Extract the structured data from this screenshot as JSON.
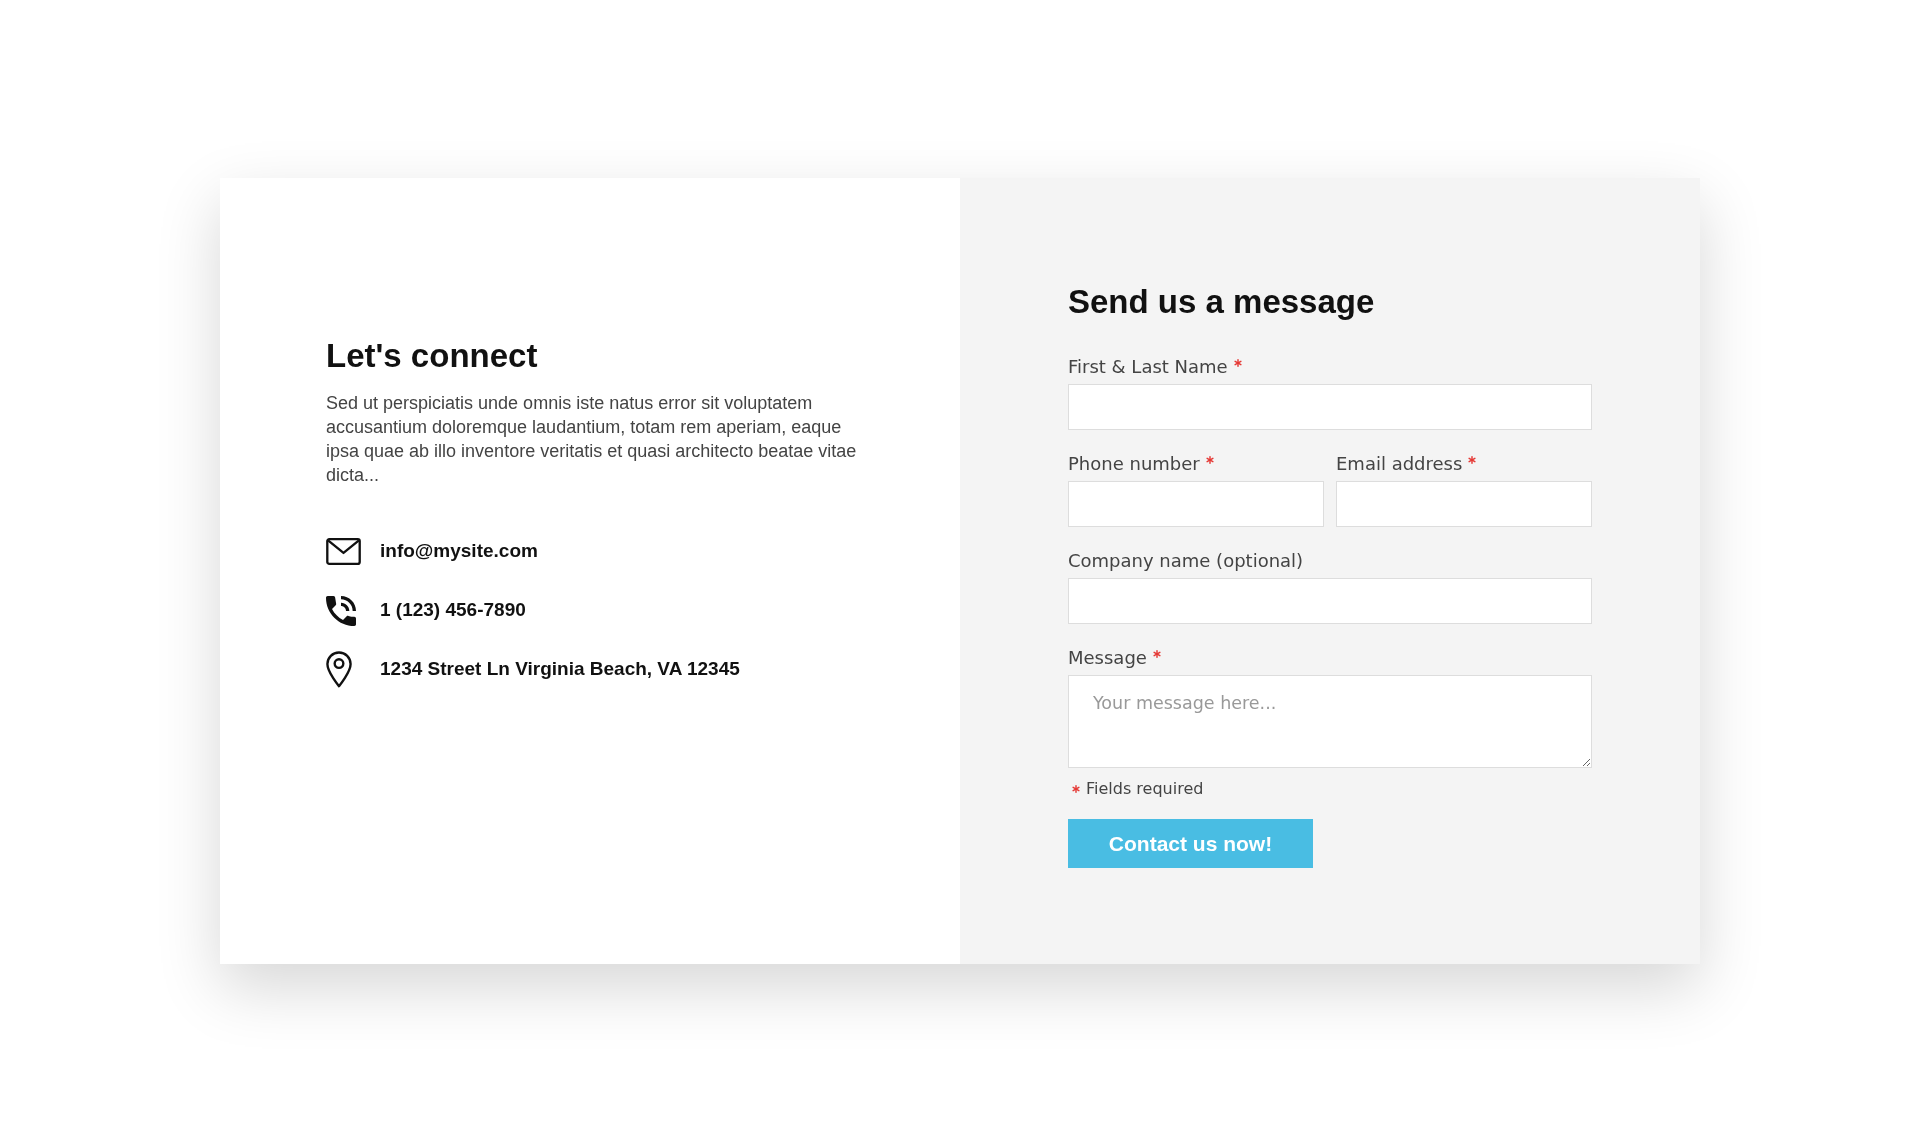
{
  "contact": {
    "title": "Let's connect",
    "text": "Sed ut perspiciatis unde omnis iste natus error sit voluptatem accusantium doloremque laudantium, totam rem aperiam, eaque ipsa quae ab illo inventore veritatis et quasi architecto beatae vitae dicta...",
    "items": [
      {
        "kind": "email",
        "text": "info@mysite.com"
      },
      {
        "kind": "phone",
        "text": "1 (123) 456-7890"
      },
      {
        "kind": "address",
        "text": "1234 Street Ln Virginia Beach, VA 12345"
      }
    ]
  },
  "form": {
    "title": "Send us a message",
    "rows": [
      {
        "fields": [
          {
            "kind": "input",
            "label": "First & Last Name",
            "required": true
          }
        ]
      },
      {
        "fields": [
          {
            "kind": "input",
            "label": "Phone number",
            "required": true
          },
          {
            "kind": "input",
            "label": "Email address",
            "required": true
          }
        ]
      },
      {
        "fields": [
          {
            "kind": "input",
            "label": "Company name (optional)",
            "required": false
          }
        ]
      },
      {
        "fields": [
          {
            "kind": "textarea",
            "label": "Message",
            "required": true,
            "placeholder": "Your message here..."
          }
        ]
      }
    ],
    "note": "Fields required",
    "submit": "Contact us now!"
  }
}
